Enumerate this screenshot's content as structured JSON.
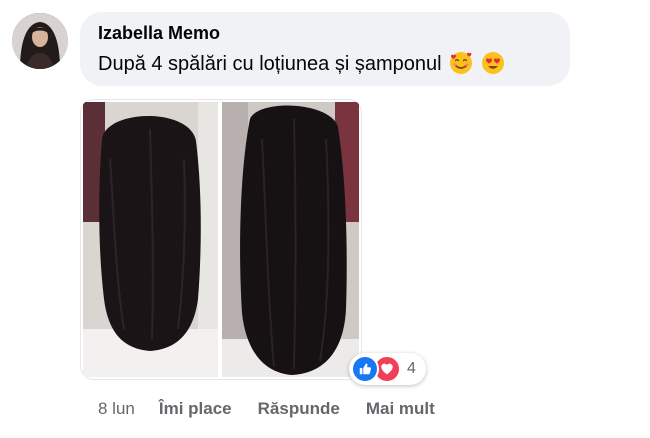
{
  "comment": {
    "author": "Izabella Memo",
    "text": "După 4 spălări cu loțiunea și șamponul",
    "emojis": [
      "smiling-face-with-hearts",
      "heart-eyes"
    ]
  },
  "reactions": {
    "types": [
      "like",
      "love"
    ],
    "count": "4",
    "colors": {
      "like": "#1877f2",
      "love": "#f33e58"
    }
  },
  "actions": {
    "time": "8 lun",
    "like_label": "Îmi place",
    "reply_label": "Răspunde",
    "more_label": "Mai mult"
  },
  "colors": {
    "bubble": "#f0f2f5",
    "text": "#050505",
    "secondary": "#65676b"
  }
}
